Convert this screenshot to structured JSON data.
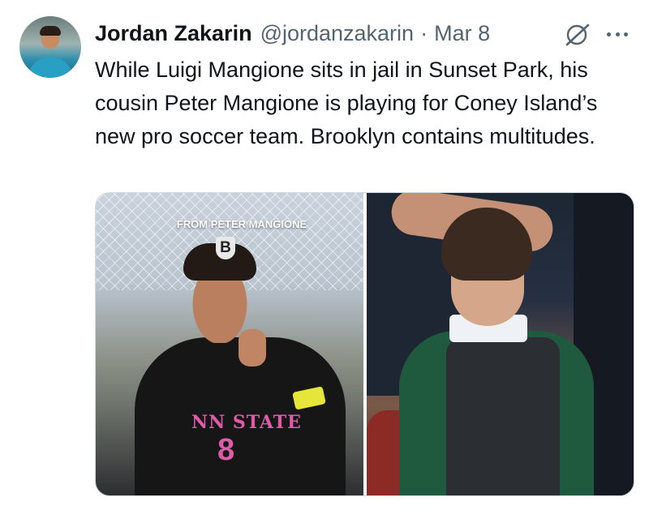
{
  "tweet": {
    "author_name": "Jordan Zakarin",
    "handle": "@jordanzakarin",
    "separator": "·",
    "date": "Mar 8",
    "text": "While Luigi Mangione sits in jail in Sunset Park, his cousin Peter Mangione is playing for Coney Island’s new pro soccer team. Brooklyn contains multitudes.",
    "icons": {
      "grok": "grok-icon",
      "more": "more-options-icon"
    }
  },
  "media": {
    "left_photo": {
      "caption": "FROM PETER MANGIONE",
      "logo_letter": "B",
      "jersey_text": "NN STATE",
      "jersey_number": "8"
    }
  },
  "colors": {
    "text_primary": "#0f1419",
    "text_secondary": "#536471",
    "border": "#cfd9de",
    "jersey_accent": "#e05aa8"
  }
}
